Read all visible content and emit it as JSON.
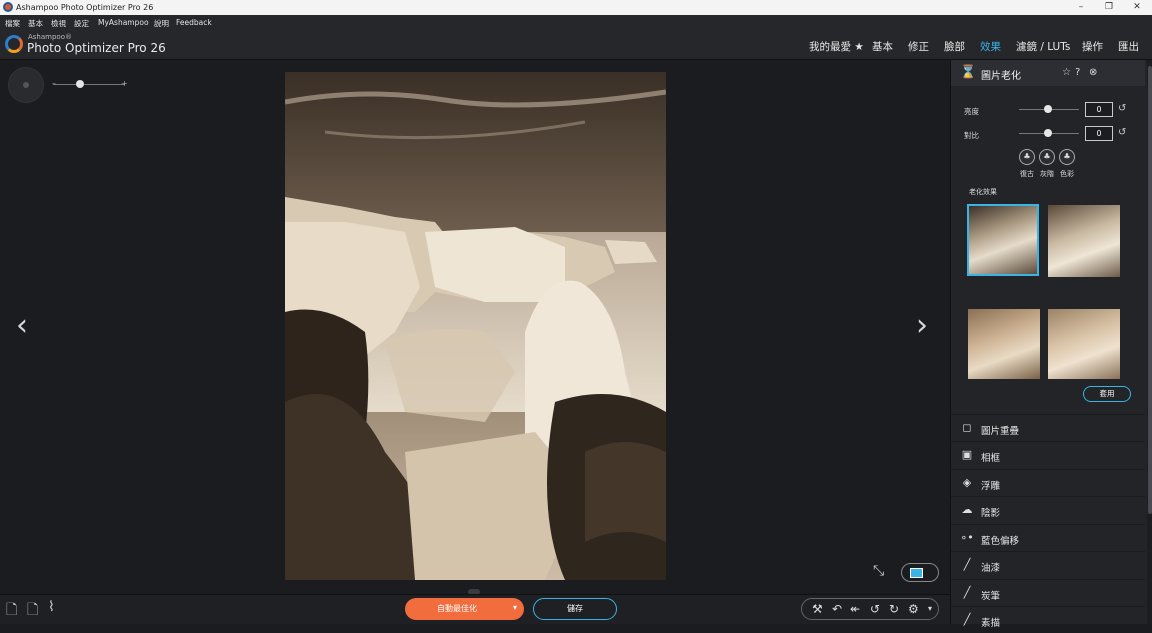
{
  "window": {
    "title": "Ashampoo Photo Optimizer Pro 26",
    "buttons": [
      "–",
      "❐",
      "✕"
    ]
  },
  "menu": [
    "檔案",
    "基本",
    "檢視",
    "設定",
    "MyAshampoo",
    "說明",
    "Feedback"
  ],
  "brand": {
    "small": "Ashampoo®",
    "name": "Photo Optimizer Pro 26"
  },
  "topnav": [
    "我的最愛 ★",
    "基本",
    "修正",
    "臉部",
    "效果",
    "濾鏡 / LUTs",
    "操作",
    "匯出"
  ],
  "topnav_active": "效果",
  "zoom": {
    "minus": "–",
    "plus": "+"
  },
  "nav_arrows": {
    "prev": "‹",
    "next": "›"
  },
  "panel": {
    "title": "圖片老化",
    "head_icons": [
      "star-icon",
      "help-icon",
      "close-icon"
    ],
    "sliders": [
      {
        "label": "亮度",
        "value": "0"
      },
      {
        "label": "對比",
        "value": "0"
      }
    ],
    "presets": [
      "復古",
      "灰階",
      "色彩"
    ],
    "aging_section": "老化效果",
    "apply": "套用"
  },
  "effects": [
    "圖片重疊",
    "相框",
    "浮雕",
    "陰影",
    "藍色偏移",
    "油漆",
    "炭筆",
    "素描"
  ],
  "bottom": {
    "auto_optimize": "自動最佳化",
    "dropdown": "▾",
    "save": "儲存"
  },
  "colors": {
    "accent": "#3ab3e6",
    "auto_button": "#f26d3d",
    "background": "#1b1c1f",
    "panel": "#232428"
  }
}
